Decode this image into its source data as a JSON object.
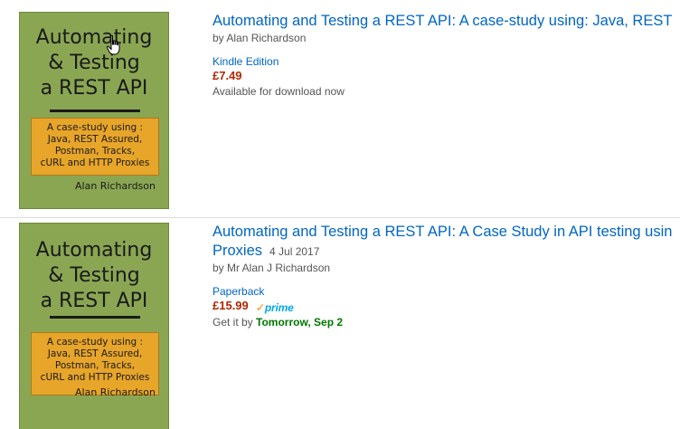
{
  "results": [
    {
      "title": "Automating and Testing a REST API: A case-study using: Java, REST",
      "byline": "by Alan Richardson",
      "format": "Kindle Edition",
      "price": "£7.49",
      "availability": "Available for download now",
      "cover": {
        "title_lines": [
          "Automating",
          "& Testing",
          "a REST API"
        ],
        "box_lines": [
          "A case-study using :",
          "Java, REST Assured,",
          "Postman, Tracks,",
          "cURL and HTTP Proxies"
        ],
        "author": "Alan Richardson"
      }
    },
    {
      "title_line1": "Automating and Testing a REST API: A Case Study in API testing usin",
      "title_line2": "Proxies",
      "date": "4 Jul 2017",
      "byline": "by Mr Alan J Richardson",
      "format": "Paperback",
      "price": "£15.99",
      "prime_label": "prime",
      "prime_check": "✓",
      "availability_prefix": "Get it by",
      "delivery_date": "Tomorrow, Sep 2",
      "cover": {
        "title_lines": [
          "Automating",
          "& Testing",
          "a REST API"
        ],
        "box_lines": [
          "A case-study using :",
          "Java, REST Assured,",
          "Postman, Tracks,",
          "cURL and HTTP Proxies"
        ],
        "author": "Alan Richardson"
      }
    }
  ],
  "colors": {
    "link": "#0066c0",
    "price": "#b12704",
    "prime": "#00a8e1",
    "delivery": "#007600",
    "cover_green": "#8aa653",
    "cover_orange": "#e7a52a"
  }
}
